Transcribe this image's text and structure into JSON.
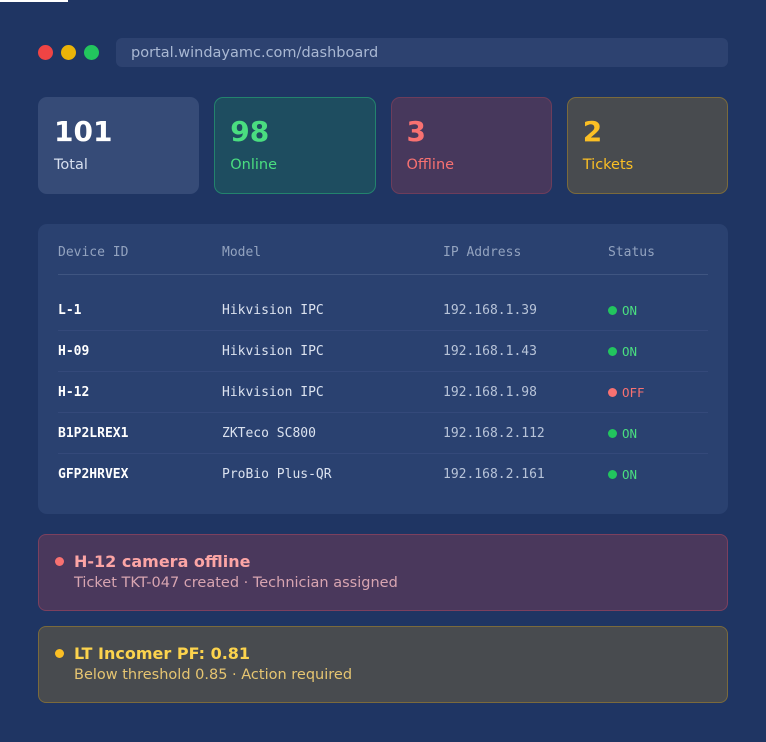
{
  "browser": {
    "url": "portal.windayamc.com/dashboard"
  },
  "stats": [
    {
      "value": "101",
      "label": "Total"
    },
    {
      "value": "98",
      "label": "Online"
    },
    {
      "value": "3",
      "label": "Offline"
    },
    {
      "value": "2",
      "label": "Tickets"
    }
  ],
  "table": {
    "headers": [
      "Device ID",
      "Model",
      "IP Address",
      "Status"
    ],
    "rows": [
      {
        "id": "L-1",
        "model": "Hikvision IPC",
        "ip": "192.168.1.39",
        "status": "ON"
      },
      {
        "id": "H-09",
        "model": "Hikvision IPC",
        "ip": "192.168.1.43",
        "status": "ON"
      },
      {
        "id": "H-12",
        "model": "Hikvision IPC",
        "ip": "192.168.1.98",
        "status": "OFF"
      },
      {
        "id": "B1P2LREX1",
        "model": "ZKTeco SC800",
        "ip": "192.168.2.112",
        "status": "ON"
      },
      {
        "id": "GFP2HRVEX",
        "model": "ProBio Plus-QR",
        "ip": "192.168.2.161",
        "status": "ON"
      }
    ]
  },
  "alerts": [
    {
      "title": "H-12 camera offline",
      "detail": "Ticket TKT-047 created · Technician assigned"
    },
    {
      "title": "LT Incomer PF: 0.81",
      "detail": "Below threshold 0.85 · Action required"
    }
  ],
  "colors": {
    "background": "#1f3563",
    "online": "#4ade80",
    "offline": "#f87171",
    "warning": "#fbbf24"
  }
}
